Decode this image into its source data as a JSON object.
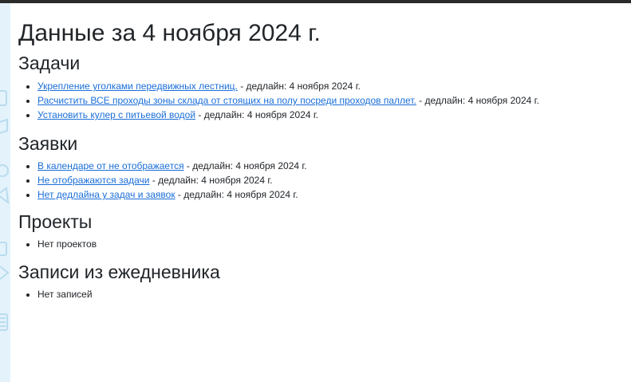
{
  "page_title": "Данные за 4 ноября 2024 г.",
  "sections": {
    "tasks": {
      "heading": "Задачи",
      "items": [
        {
          "link": "Укрепление уголками передвижных лестниц.",
          "suffix": " - дедлайн: 4 ноября 2024 г."
        },
        {
          "link": "Расчистить ВСЕ проходы зоны склада от стоящих на полу посреди проходов паллет.",
          "suffix": " - дедлайн: 4 ноября 2024 г."
        },
        {
          "link": "Установить кулер с питьевой водой",
          "suffix": " - дедлайн: 4 ноября 2024 г."
        }
      ]
    },
    "requests": {
      "heading": "Заявки",
      "items": [
        {
          "link": "В календаре от не отображается",
          "suffix": " - дедлайн: 4 ноября 2024 г."
        },
        {
          "link": "Не отображаются задачи",
          "suffix": " - дедлайн: 4 ноября 2024 г."
        },
        {
          "link": "Нет дедлайна у задач и заявок",
          "suffix": " - дедлайн: 4 ноября 2024 г."
        }
      ]
    },
    "projects": {
      "heading": "Проекты",
      "items": [
        {
          "text": "Нет проектов"
        }
      ]
    },
    "diary": {
      "heading": "Записи из ежедневника",
      "items": [
        {
          "text": "Нет записей"
        }
      ]
    }
  },
  "colors": {
    "link": "#1a6ed8",
    "text": "#212529",
    "sidebar": "#e4f3fb",
    "topbar": "#2b2b2b"
  }
}
